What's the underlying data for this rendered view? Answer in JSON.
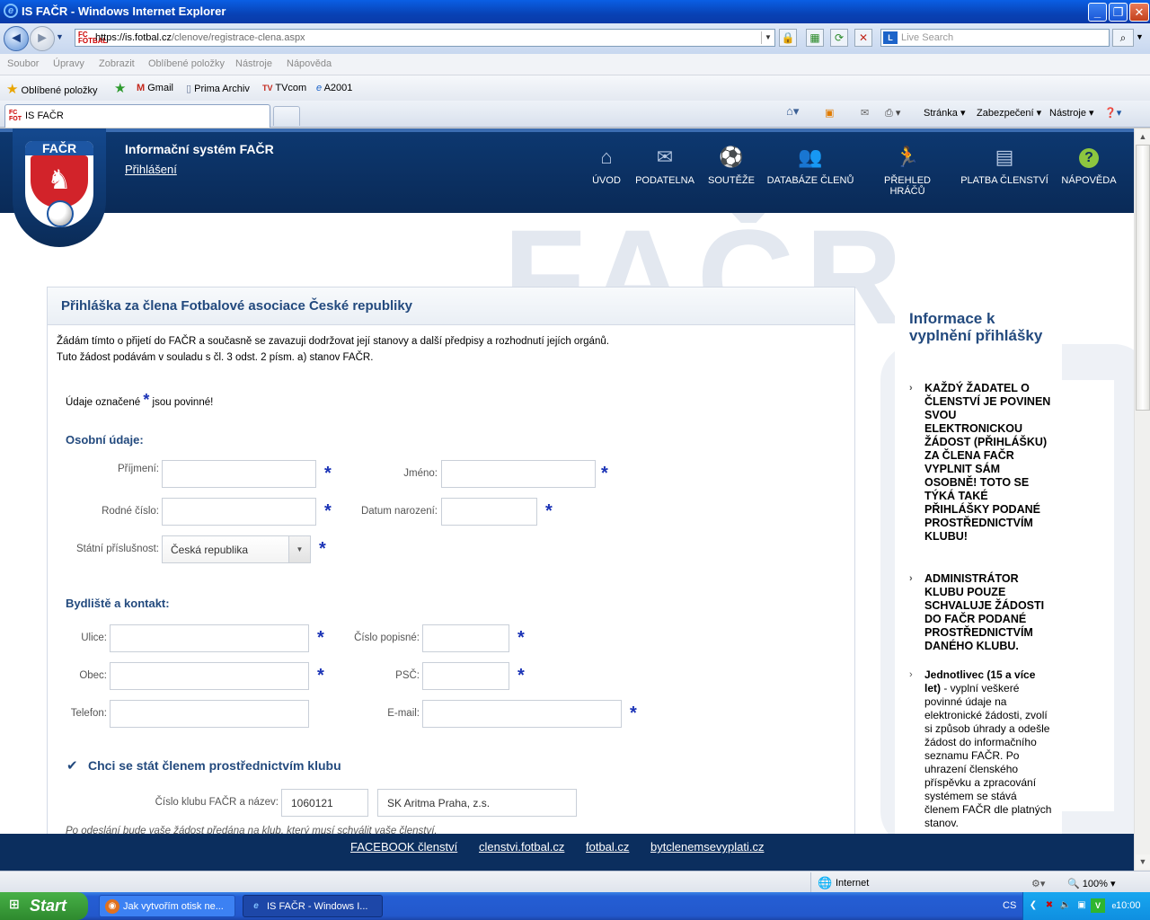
{
  "window": {
    "title": "IS FAČR - Windows Internet Explorer",
    "url_host": "https://is.fotbal.cz",
    "url_path": "/clenove/registrace-clena.aspx",
    "search_placeholder": "Live Search",
    "live_logo": "L"
  },
  "menu": [
    "Soubor",
    "Úpravy",
    "Zobrazit",
    "Oblíbené položky",
    "Nástroje",
    "Nápověda"
  ],
  "favorites": {
    "main": "Oblíbené položky",
    "items": [
      "Gmail",
      "Prima Archiv",
      "TVcom",
      "A2001"
    ]
  },
  "tab": {
    "label": "IS FAČR"
  },
  "toolbar": [
    "Stránka",
    "Zabezpečení",
    "Nástroje"
  ],
  "site": {
    "title": "Informační systém FAČR",
    "login": "Přihlášení",
    "logo_text": "FAČR",
    "watermark": "FAČR",
    "nav": [
      {
        "label": "ÚVOD",
        "icon": "home-icon"
      },
      {
        "label": "PODATELNA",
        "icon": "mail-icon"
      },
      {
        "label": "SOUTĚŽE",
        "icon": "ball-icon"
      },
      {
        "label": "DATABÁZE ČLENŮ",
        "icon": "members-icon"
      },
      {
        "label": "PŘEHLED HRÁČŮ",
        "icon": "player-icon"
      },
      {
        "label": "PLATBA ČLENSTVÍ",
        "icon": "wallet-icon"
      },
      {
        "label": "NÁPOVĚDA",
        "icon": "help-icon"
      }
    ]
  },
  "form": {
    "heading": "Přihláška za člena Fotbalové asociace České republiky",
    "intro1": "Žádám tímto o přijetí do FAČR a současně se zavazuji dodržovat její stanovy a další předpisy a rozhodnutí jejích orgánů.",
    "intro2": "Tuto žádost podávám v souladu s čl. 3 odst. 2 písm. a) stanov FAČR.",
    "required_pre": "Údaje označené",
    "required_post": "jsou povinné!",
    "req_mark": "*",
    "personal_title": "Osobní údaje:",
    "surname": "Příjmení:",
    "firstname": "Jméno:",
    "birth_number": "Rodné číslo:",
    "birth_date": "Datum narození:",
    "citizenship": "Státní příslušnost:",
    "citizenship_value": "Česká republika",
    "address_title": "Bydliště a kontakt:",
    "street": "Ulice:",
    "house_no": "Číslo popisné:",
    "city": "Obec:",
    "zip": "PSČ:",
    "phone": "Telefon:",
    "email": "E-mail:",
    "club_checkbox": "Chci se stát členem prostřednictvím klubu",
    "club_label": "Číslo klubu FAČR a název:",
    "club_number": "1060121",
    "club_name": "SK Aritma Praha, z.s.",
    "club_note": "Po odeslání bude vaše žádost předána na klub, který musí schválit vaše členství."
  },
  "side": {
    "heading": "Informace k vyplnění přihlášky",
    "b1": "KAŽDÝ ŽADATEL O ČLENSTVÍ JE POVINEN SVOU ELEKTRONICKOU ŽÁDOST (PŘIHLÁŠKU) ZA ČLENA FAČR VYPLNIT SÁM OSOBNĚ! TOTO SE TÝKÁ TAKÉ PŘIHLÁŠKY PODANÉ PROSTŘEDNICTVÍM KLUBU!",
    "b2": "ADMINISTRÁTOR KLUBU POUZE SCHVALUJE ŽÁDOSTI DO FAČR PODANÉ PROSTŘEDNICTVÍM DANÉHO KLUBU.",
    "b3_bold": "Jednotlivec (15 a více let)",
    "b3_rest": " - vyplní veškeré povinné údaje na elektronické žádosti, zvolí si způsob úhrady a odešle žádost do informačního seznamu FAČR. Po uhrazení členského příspěvku a zpracování systémem se stává členem FAČR dle platných stanov."
  },
  "footer": [
    "FACEBOOK členství",
    "clenstvi.fotbal.cz",
    "fotbal.cz",
    "bytclenemsevyplati.cz"
  ],
  "status": {
    "zone": "Internet",
    "zoom": "100%"
  },
  "taskbar": {
    "start": "Start",
    "tasks": [
      "Jak vytvořím otisk ne...",
      "IS FAČR - Windows I..."
    ],
    "lang": "CS",
    "clock": "10:00"
  }
}
